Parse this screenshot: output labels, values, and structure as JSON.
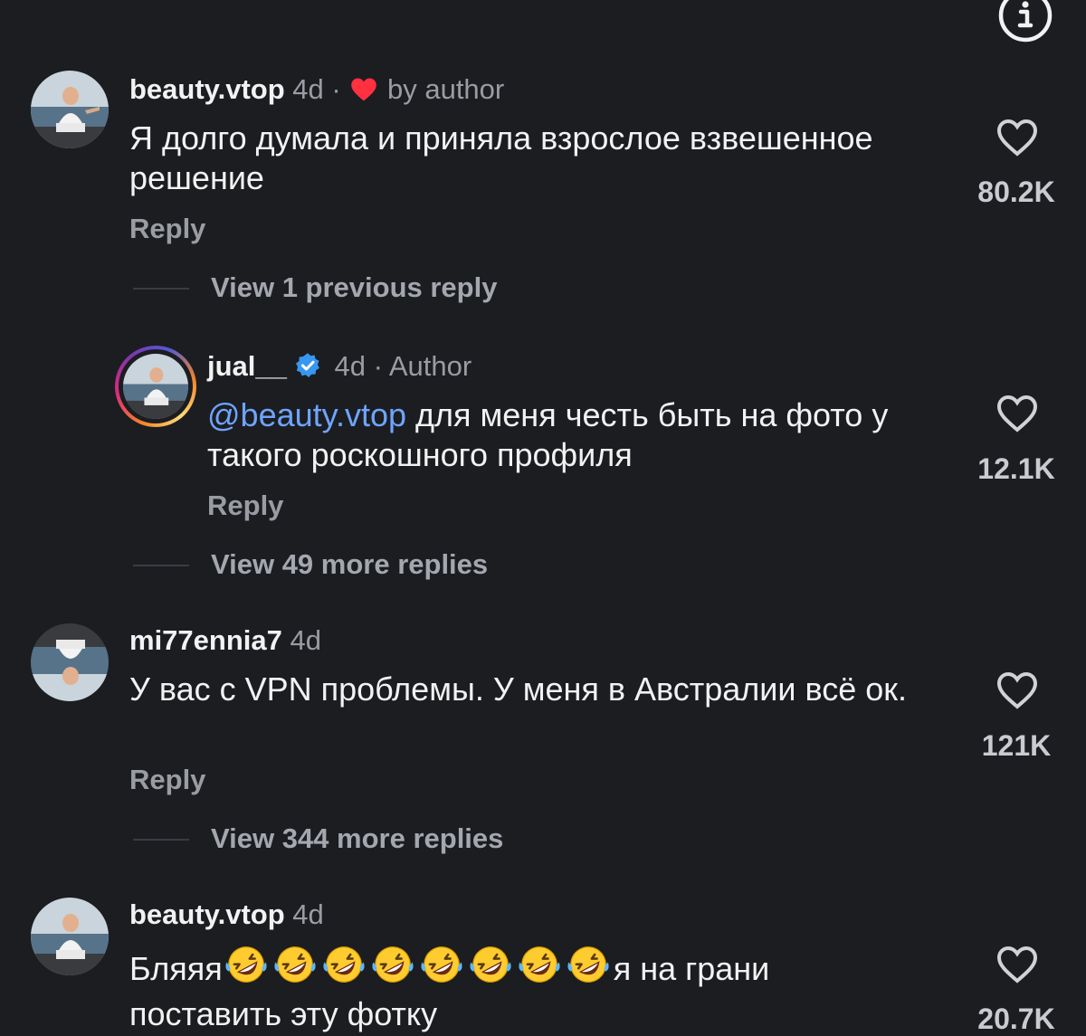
{
  "comments": [
    {
      "username": "beauty.vtop",
      "time": "4d",
      "separator": "·",
      "liked_by": "by author",
      "text": "Я долго думала и приняла взрослое взвешенное решение",
      "reply": "Reply",
      "likes": "80.2K",
      "thread": "View 1 previous reply"
    },
    {
      "username": "jual__",
      "time": "4d",
      "separator": "·",
      "role": "Author",
      "mention": "@beauty.vtop",
      "text": "для меня честь быть на фото у такого роскошного профиля",
      "reply": "Reply",
      "likes": "12.1K",
      "thread": "View 49 more replies"
    },
    {
      "username": "mi77ennia7",
      "time": "4d",
      "text": "У вас с VPN проблемы. У меня в Австралии всё ок.",
      "reply": "Reply",
      "likes": "121K",
      "thread": "View 344 more replies"
    },
    {
      "username": "beauty.vtop",
      "time": "4d",
      "text_start": "Бляяя",
      "text_end": "я на грани",
      "text_line2": "поставить эту фотку",
      "emoji_count": 8,
      "likes": "20.7K"
    }
  ],
  "icons": {
    "info": "info-circle-icon",
    "heart": "heart-outline-icon",
    "liked_badge": "heart-filled-icon",
    "verified": "verified-badge-icon",
    "emoji": "rolling-on-floor-laughing-emoji"
  },
  "colors": {
    "background": "#1b1d21",
    "mention": "#6fa4ff",
    "heart_red": "#ff3040",
    "verified_blue": "#3897f0"
  }
}
